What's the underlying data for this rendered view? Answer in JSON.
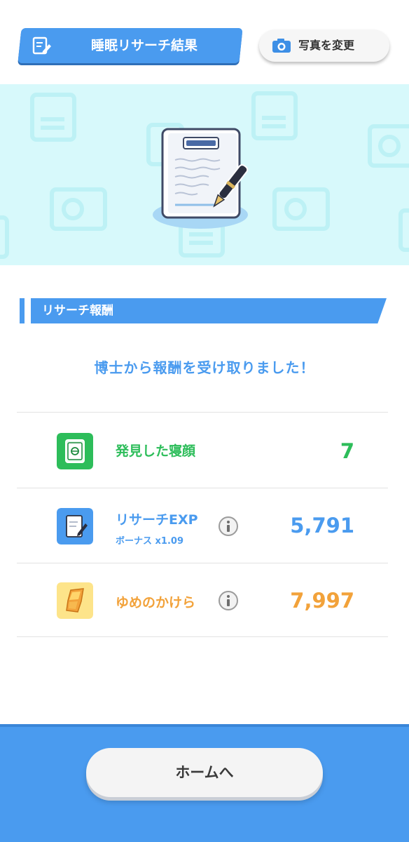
{
  "header": {
    "title": "睡眠リサーチ結果",
    "photo_button_label": "写真を変更"
  },
  "section": {
    "title": "リサーチ報酬"
  },
  "message": "博士から報酬を受け取りました！",
  "rewards": [
    {
      "label": "発見した寝顔",
      "value": "7",
      "color": "#2dbd5a",
      "icon": "sleep-style-icon"
    },
    {
      "label": "リサーチEXP",
      "sub": "ボーナス x1.09",
      "value": "5,791",
      "color": "#4a9bef",
      "icon": "research-note-icon"
    },
    {
      "label": "ゆめのかけら",
      "value": "7,997",
      "color": "#f2a23a",
      "icon": "dream-shard-icon"
    }
  ],
  "footer": {
    "home_button_label": "ホームへ"
  },
  "colors": {
    "accent": "#4a9bef",
    "green": "#2dbd5a",
    "orange": "#f2a23a",
    "banner": "#d7f9fb"
  }
}
